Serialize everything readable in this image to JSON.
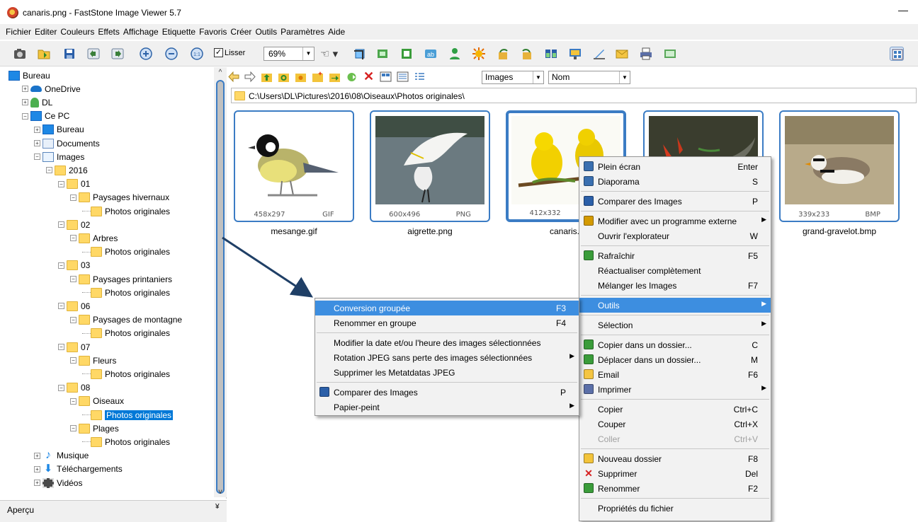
{
  "window": {
    "title": "canaris.png  -  FastStone Image Viewer 5.7",
    "minimize": "—"
  },
  "menubar": [
    "Fichier",
    "Editer",
    "Couleurs",
    "Effets",
    "Affichage",
    "Etiquette",
    "Favoris",
    "Créer",
    "Outils",
    "Paramètres",
    "Aide"
  ],
  "toolbar": {
    "lisser_label": "Lisser",
    "lisser_checked": "✓",
    "zoom_value": "69%",
    "dropdown_arrow": "▼",
    "hand": "☜ ▾"
  },
  "tree": [
    {
      "label": "Bureau",
      "icon": "monitor-icon",
      "exp": ""
    },
    {
      "label": "OneDrive",
      "icon": "cloud-icon",
      "exp": "+"
    },
    {
      "label": "DL",
      "icon": "user-icon",
      "exp": "+"
    },
    {
      "label": "Ce PC",
      "icon": "monitor-icon",
      "exp": "−"
    },
    {
      "label": "Bureau",
      "icon": "monitor-icon",
      "exp": "+"
    },
    {
      "label": "Documents",
      "icon": "documents-icon",
      "exp": "+"
    },
    {
      "label": "Images",
      "icon": "pictures-icon",
      "exp": "−"
    },
    {
      "label": "2016",
      "icon": "folder-icon",
      "exp": "−"
    },
    {
      "label": "01",
      "icon": "folder-icon",
      "exp": "−"
    },
    {
      "label": "Paysages hivernaux",
      "icon": "folder-icon",
      "exp": "−"
    },
    {
      "label": "Photos originales",
      "icon": "folder-icon",
      "exp": ""
    },
    {
      "label": "02",
      "icon": "folder-icon",
      "exp": "−"
    },
    {
      "label": "Arbres",
      "icon": "folder-icon",
      "exp": "−"
    },
    {
      "label": "Photos originales",
      "icon": "folder-icon",
      "exp": ""
    },
    {
      "label": "03",
      "icon": "folder-icon",
      "exp": "−"
    },
    {
      "label": "Paysages printaniers",
      "icon": "folder-icon",
      "exp": "−"
    },
    {
      "label": "Photos originales",
      "icon": "folder-icon",
      "exp": ""
    },
    {
      "label": "06",
      "icon": "folder-icon",
      "exp": "−"
    },
    {
      "label": "Paysages de montagne",
      "icon": "folder-icon",
      "exp": "−"
    },
    {
      "label": "Photos originales",
      "icon": "folder-icon",
      "exp": ""
    },
    {
      "label": "07",
      "icon": "folder-icon",
      "exp": "−"
    },
    {
      "label": "Fleurs",
      "icon": "folder-icon",
      "exp": "−"
    },
    {
      "label": "Photos originales",
      "icon": "folder-icon",
      "exp": ""
    },
    {
      "label": "08",
      "icon": "folder-icon",
      "exp": "−"
    },
    {
      "label": "Oiseaux",
      "icon": "folder-icon",
      "exp": "−"
    },
    {
      "label": "Photos originales",
      "icon": "folder-icon",
      "exp": "",
      "selected": true
    },
    {
      "label": "Plages",
      "icon": "folder-icon",
      "exp": "−"
    },
    {
      "label": "Photos originales",
      "icon": "folder-icon",
      "exp": ""
    },
    {
      "label": "Musique",
      "icon": "music-icon",
      "exp": "+"
    },
    {
      "label": "Téléchargements",
      "icon": "download-icon",
      "exp": "+"
    },
    {
      "label": "Vidéos",
      "icon": "video-icon",
      "exp": "+"
    }
  ],
  "scroll": {
    "up": "^",
    "down": "v"
  },
  "apercu": {
    "label": "Aperçu",
    "chevron": "¥"
  },
  "browser": {
    "filter_value": "Images",
    "sort_value": "Nom",
    "path": "C:\\Users\\DL\\Pictures\\2016\\08\\Oiseaux\\Photos originales\\"
  },
  "thumbnails": [
    {
      "name": "mesange.gif",
      "dims": "458x297",
      "format": "GIF"
    },
    {
      "name": "aigrette.png",
      "dims": "600x496",
      "format": "PNG"
    },
    {
      "name": "canaris.png",
      "name_visible": "canaris.",
      "dims": "412x332",
      "format": ""
    },
    {
      "name": "",
      "dims": "",
      "format": ""
    },
    {
      "name": "grand-gravelot.bmp",
      "dims": "339x233",
      "format": "BMP"
    }
  ],
  "context_menu": [
    {
      "label": "Plein écran",
      "key": "Enter",
      "icon": "fullscreen-icon"
    },
    {
      "label": "Diaporama",
      "key": "S",
      "icon": "slideshow-icon"
    },
    {
      "sep": true
    },
    {
      "label": "Comparer des Images",
      "key": "P",
      "icon": "compare-icon"
    },
    {
      "sep": true
    },
    {
      "label": "Modifier avec un programme externe",
      "key": "",
      "icon": "external-edit-icon",
      "submenu": true
    },
    {
      "label": "Ouvrir l'explorateur",
      "key": "W",
      "icon": ""
    },
    {
      "sep": true
    },
    {
      "label": "Rafraîchir",
      "key": "F5",
      "icon": "refresh-icon"
    },
    {
      "label": "Réactualiser complètement",
      "key": "",
      "icon": ""
    },
    {
      "label": "Mélanger les Images",
      "key": "F7",
      "icon": ""
    },
    {
      "sep": true
    },
    {
      "label": "Outils",
      "key": "",
      "icon": "",
      "submenu": true,
      "highlight": true
    },
    {
      "sep": true
    },
    {
      "label": "Sélection",
      "key": "",
      "icon": "",
      "submenu": true
    },
    {
      "sep": true
    },
    {
      "label": "Copier dans un dossier...",
      "key": "C",
      "icon": "copy-to-folder-icon"
    },
    {
      "label": "Déplacer dans un dossier...",
      "key": "M",
      "icon": "move-to-folder-icon"
    },
    {
      "label": "Email",
      "key": "F6",
      "icon": "email-icon"
    },
    {
      "label": "Imprimer",
      "key": "",
      "icon": "print-icon",
      "submenu": true
    },
    {
      "sep": true
    },
    {
      "label": "Copier",
      "key": "Ctrl+C",
      "icon": ""
    },
    {
      "label": "Couper",
      "key": "Ctrl+X",
      "icon": ""
    },
    {
      "label": "Coller",
      "key": "Ctrl+V",
      "icon": "",
      "disabled": true
    },
    {
      "sep": true
    },
    {
      "label": "Nouveau dossier",
      "key": "F8",
      "icon": "new-folder-icon"
    },
    {
      "label": "Supprimer",
      "key": "Del",
      "icon": "delete-icon"
    },
    {
      "label": "Renommer",
      "key": "F2",
      "icon": "rename-icon"
    },
    {
      "sep": true
    },
    {
      "label": "Propriétés du fichier",
      "key": "",
      "icon": ""
    }
  ],
  "submenu_outils": [
    {
      "label": "Conversion groupée",
      "key": "F3",
      "highlight": true
    },
    {
      "label": "Renommer en groupe",
      "key": "F4"
    },
    {
      "sep": true
    },
    {
      "label": "Modifier la date et/ou l'heure des images sélectionnées",
      "key": ""
    },
    {
      "label": "Rotation JPEG sans perte des images sélectionnées",
      "key": "",
      "submenu": true
    },
    {
      "label": "Supprimer les Metatdatas JPEG",
      "key": ""
    },
    {
      "sep": true
    },
    {
      "label": "Comparer des Images",
      "key": "P",
      "icon": "compare-icon"
    },
    {
      "label": "Papier-peint",
      "key": "",
      "submenu": true
    }
  ],
  "glyphs": {
    "submenu_arrow": "▶"
  },
  "colors": {
    "accent": "#3d8ee0",
    "selection": "#0078d7",
    "thumb_border": "#3b7cc4",
    "annotation_arrow": "#1f3f66"
  }
}
